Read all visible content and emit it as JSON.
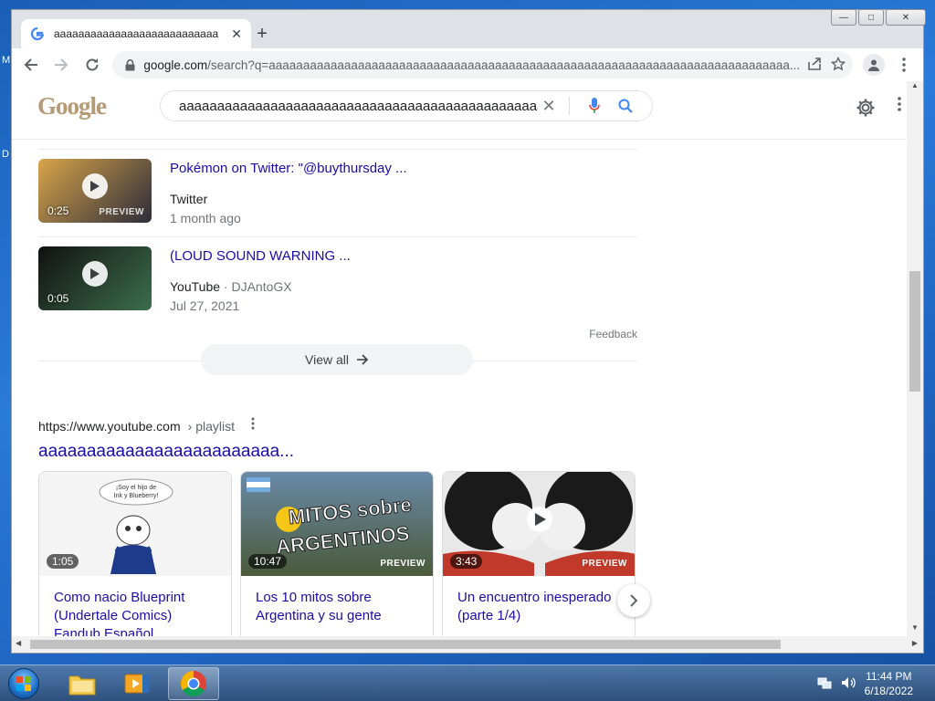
{
  "desktop": {
    "edge_labels": [
      "M",
      "D"
    ]
  },
  "window": {
    "min_label": "—",
    "max_label": "□",
    "close_label": "✕"
  },
  "tab": {
    "title": "aaaaaaaaaaaaaaaaaaaaaaaaaaa",
    "close": "✕",
    "new_tab": "+"
  },
  "toolbar": {
    "url_host": "google.com",
    "url_path": "/search?q=aaaaaaaaaaaaaaaaaaaaaaaaaaaaaaaaaaaaaaaaaaaaaaaaaaaaaaaaaaaaaaaaaaaaaaaaaaaa..."
  },
  "search": {
    "logo_text": "Google",
    "query": "aaaaaaaaaaaaaaaaaaaaaaaaaaaaaaaaaaaaaaaaaaaaaaaa",
    "clear": "✕"
  },
  "videos": [
    {
      "title": "Pokémon on Twitter: \"@buythursday ...",
      "source": "Twitter",
      "channel": "",
      "date": "1 month ago",
      "duration": "0:25",
      "preview": "PREVIEW",
      "thumb_colors": [
        "#d9a54a",
        "#2c2c3a"
      ]
    },
    {
      "title": "(LOUD SOUND WARNING ...",
      "source": "YouTube",
      "channel": "· DJAntoGX",
      "date": "Jul 27, 2021",
      "duration": "0:05",
      "preview": "",
      "thumb_colors": [
        "#111111",
        "#3c6e4c"
      ]
    }
  ],
  "feedback": "Feedback",
  "view_all": "View all",
  "playlist": {
    "cite_host": "https://www.youtube.com",
    "cite_path": "› playlist",
    "title": "aaaaaaaaaaaaaaaaaaaaaaaaa...",
    "cards": [
      {
        "title": "Como nacio Blueprint (Undertale Comics) Fandub Español",
        "duration": "1:05",
        "preview": "",
        "thumb_caption": "¡Soy el hijo de Ink y Blueberry!",
        "thumb_colors": [
          "#f4f4f4",
          "#1e3a8a"
        ]
      },
      {
        "title": "Los 10 mitos sobre Argentina y su gente",
        "duration": "10:47",
        "preview": "PREVIEW",
        "thumb_caption": "MITOS SOBRE ARGENTINOS",
        "thumb_colors": [
          "#3f5f7a",
          "#7a8a5a"
        ]
      },
      {
        "title": "Un encuentro inesperado (parte 1/4)",
        "duration": "3:43",
        "preview": "PREVIEW",
        "thumb_caption": "",
        "thumb_colors": [
          "#1a1a1a",
          "#c0392b"
        ]
      }
    ]
  },
  "clock": {
    "time": "11:44 PM",
    "date": "6/18/2022"
  },
  "colors": {
    "link": "#1a0dab",
    "accent_blue": "#4285f4",
    "mic_red": "#ea4335"
  }
}
